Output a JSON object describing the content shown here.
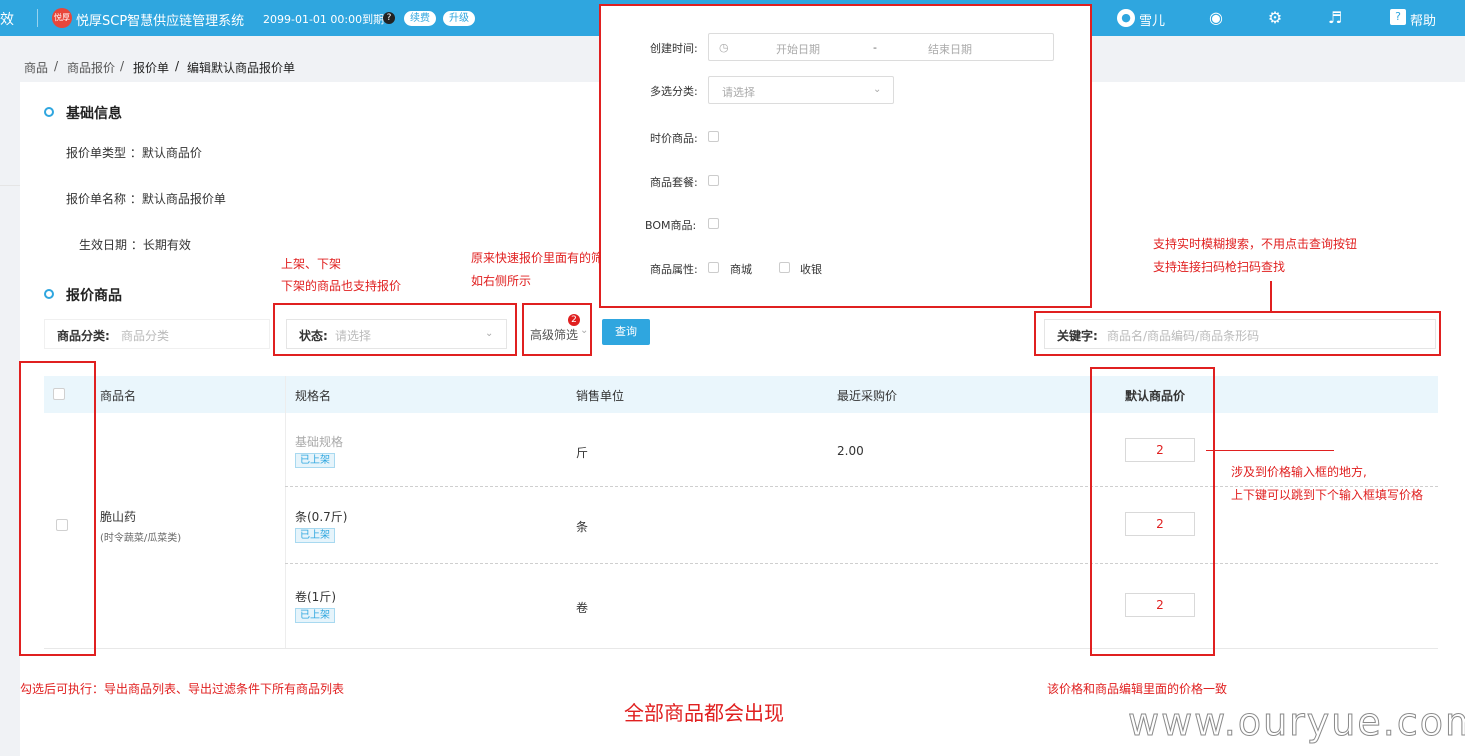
{
  "topbar": {
    "effect_text": "效",
    "logo_text": "悦厚",
    "app_title": "悦厚SCP智慧供应链管理系统",
    "expire_text": "2099-01-01 00:00到期",
    "help_q": "?",
    "renew_label": "续费",
    "upgrade_label": "升级",
    "user_name": "雪儿",
    "help_label": "帮助",
    "help_box_glyph": "?"
  },
  "breadcrumb": {
    "items": [
      "商品",
      "商品报价",
      "报价单",
      "编辑默认商品报价单"
    ],
    "sep": "/"
  },
  "basic_info": {
    "title": "基础信息",
    "type_label": "报价单类型 ：默认商品价",
    "name_label": "报价单名称 ：默认商品报价单",
    "date_label": "生效日期 ：长期有效"
  },
  "products_section": {
    "title": "报价商品"
  },
  "filters": {
    "category_label": "商品分类:",
    "category_placeholder": "商品分类",
    "status_label": "状态:",
    "status_placeholder": "请选择",
    "advanced_label": "高级筛选",
    "advanced_badge": "2",
    "query_button": "查询",
    "keyword_label": "关键字:",
    "keyword_placeholder": "商品名/商品编码/商品条形码"
  },
  "popup": {
    "created_time_label": "创建时间:",
    "start_placeholder": "开始日期",
    "dash": "-",
    "end_placeholder": "结束日期",
    "multi_category_label": "多选分类:",
    "multi_category_placeholder": "请选择",
    "time_price_label": "时价商品:",
    "combo_label": "商品套餐:",
    "bom_label": "BOM商品:",
    "attr_label": "商品属性:",
    "attr_mall": "商城",
    "attr_cashier": "收银"
  },
  "table": {
    "headers": [
      "商品名",
      "规格名",
      "销售单位",
      "最近采购价",
      "默认商品价"
    ],
    "product_name": "脆山药",
    "product_category": "(时令蔬菜/瓜菜类)",
    "rows": [
      {
        "spec": "基础规格",
        "tag": "已上架",
        "unit": "斤",
        "last_price": "2.00",
        "price": "2"
      },
      {
        "spec": "条(0.7斤)",
        "tag": "已上架",
        "unit": "条",
        "last_price": "",
        "price": "2"
      },
      {
        "spec": "卷(1斤)",
        "tag": "已上架",
        "unit": "卷",
        "last_price": "",
        "price": "2"
      }
    ]
  },
  "annotations": {
    "shelf_1": "上架、下架",
    "shelf_2": "下架的商品也支持报价",
    "filter_1": "原来快速报价里面有的筛选",
    "filter_2": "如右侧所示",
    "search_1": "支持实时模糊搜索，不用点击查询按钮",
    "search_2": "支持连接扫码枪扫码查找",
    "price_1": "涉及到价格输入框的地方,",
    "price_2": "上下键可以跳到下个输入框填写价格",
    "export": "勾选后可执行：导出商品列表、导出过滤条件下所有商品列表",
    "all_products": "全部商品都会出现",
    "price_consistent": "该价格和商品编辑里面的价格一致"
  },
  "watermark": "www.ouryue.com",
  "colors": {
    "brand": "#2fa6df",
    "annotation": "#e02020"
  },
  "icons": [
    "question-icon",
    "user-icon",
    "service-icon",
    "gear-icon",
    "bell-icon",
    "help-icon",
    "clock-icon",
    "chevron-down-icon"
  ]
}
